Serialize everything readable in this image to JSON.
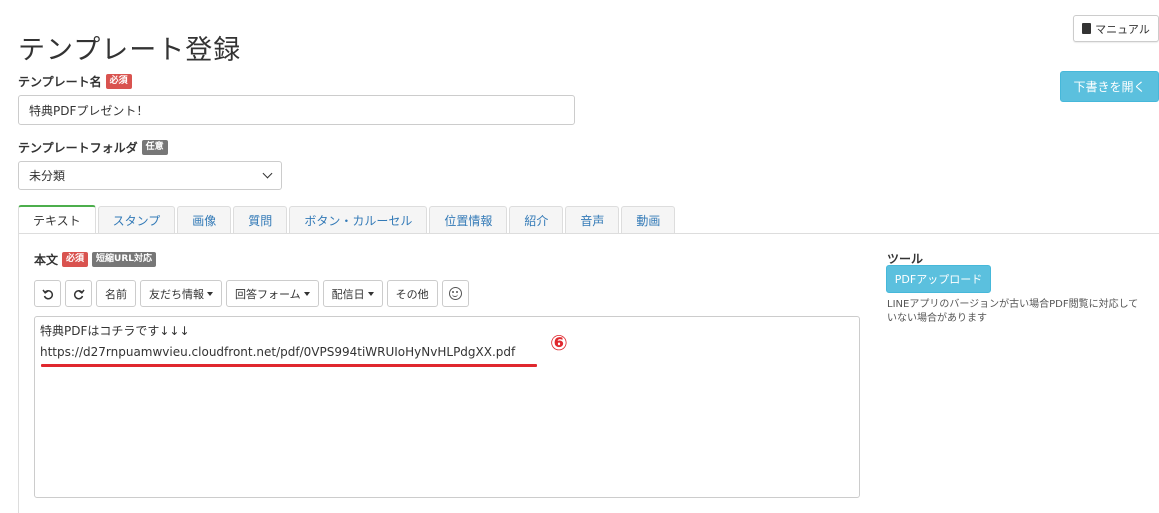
{
  "header": {
    "title": "テンプレート登録",
    "manual_label": "マニュアル",
    "draft_label": "下書きを開く"
  },
  "form": {
    "name_label": "テンプレート名",
    "required_badge": "必須",
    "name_value": "特典PDFプレゼント！",
    "folder_label": "テンプレートフォルダ",
    "optional_badge": "任意",
    "folder_value": "未分類"
  },
  "tabs": [
    {
      "label": "テキスト",
      "active": true
    },
    {
      "label": "スタンプ"
    },
    {
      "label": "画像"
    },
    {
      "label": "質問"
    },
    {
      "label": "ボタン・カルーセル"
    },
    {
      "label": "位置情報"
    },
    {
      "label": "紹介"
    },
    {
      "label": "音声"
    },
    {
      "label": "動画"
    }
  ],
  "editor": {
    "body_label": "本文",
    "required_badge": "必須",
    "short_url_badge": "短縮URL対応",
    "toolbar": {
      "name_btn": "名前",
      "friend_info_btn": "友だち情報",
      "answer_form_btn": "回答フォーム",
      "delivery_date_btn": "配信日",
      "other_btn": "その他"
    },
    "line1": "特典PDFはコチラです↓↓↓",
    "line2": "https://d27rnpuamwvieu.cloudfront.net/pdf/0VPS994tiWRUIoHyNvHLPdgXX.pdf",
    "annotation": "⑥"
  },
  "tools": {
    "title": "ツール",
    "pdf_upload_label": "PDFアップロード",
    "note": "LINEアプリのバージョンが古い場合PDF閲覧に対応していない場合があります"
  },
  "colors": {
    "accent_blue": "#5bc0de",
    "required_red": "#d9534f",
    "annotation_red": "#e0282e",
    "active_tab_border": "#4cae4c"
  }
}
